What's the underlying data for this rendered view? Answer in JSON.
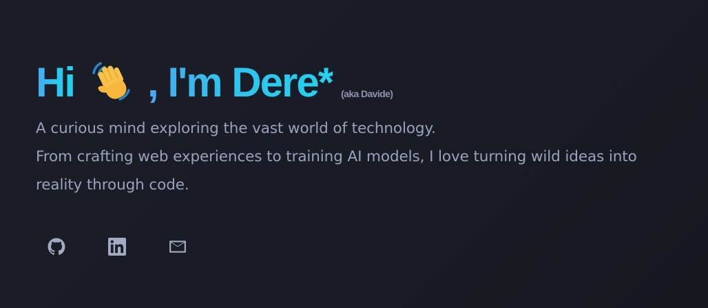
{
  "hero": {
    "greeting": "Hi",
    "name": ", I'm Dere*",
    "aka": "(aka Davide)",
    "wave_icon": "waving-hand-emoji",
    "bio_line_1": "A curious mind exploring the vast world of technology.",
    "bio_line_2": "From crafting web experiences to training AI models, I love turning wild ideas into reality through code."
  },
  "socials": {
    "items": [
      {
        "icon": "github-icon"
      },
      {
        "icon": "linkedin-icon"
      },
      {
        "icon": "mail-icon"
      }
    ]
  },
  "colors": {
    "background": "#1a1c27",
    "accent_start": "#4aa8f0",
    "accent_end": "#22d3ee",
    "body_text": "#9aa3bd",
    "muted_text": "#8d93b0",
    "icon": "#a4aabf"
  }
}
